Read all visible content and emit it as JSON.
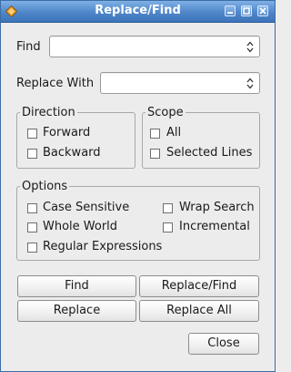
{
  "window": {
    "title": "Replace/Find",
    "controls": [
      "minimize-icon",
      "maximize-icon",
      "close-icon"
    ]
  },
  "find": {
    "label": "Find",
    "value": ""
  },
  "replace": {
    "label": "Replace With",
    "value": ""
  },
  "direction": {
    "title": "Direction",
    "options": [
      "Forward",
      "Backward"
    ]
  },
  "scope": {
    "title": "Scope",
    "options": [
      "All",
      "Selected Lines"
    ]
  },
  "options": {
    "title": "Options",
    "case_sensitive": "Case Sensitive",
    "whole_world": "Whole World",
    "regular_expressions": "Regular Expressions",
    "wrap_search": "Wrap Search",
    "incremental": "Incremental"
  },
  "buttons": {
    "find": "Find",
    "replace_find": "Replace/Find",
    "replace": "Replace",
    "replace_all": "Replace All",
    "close": "Close"
  },
  "colors": {
    "titlebar": "#4f86c9",
    "window_bg": "#ececec",
    "app_icon": "#f0a030"
  }
}
